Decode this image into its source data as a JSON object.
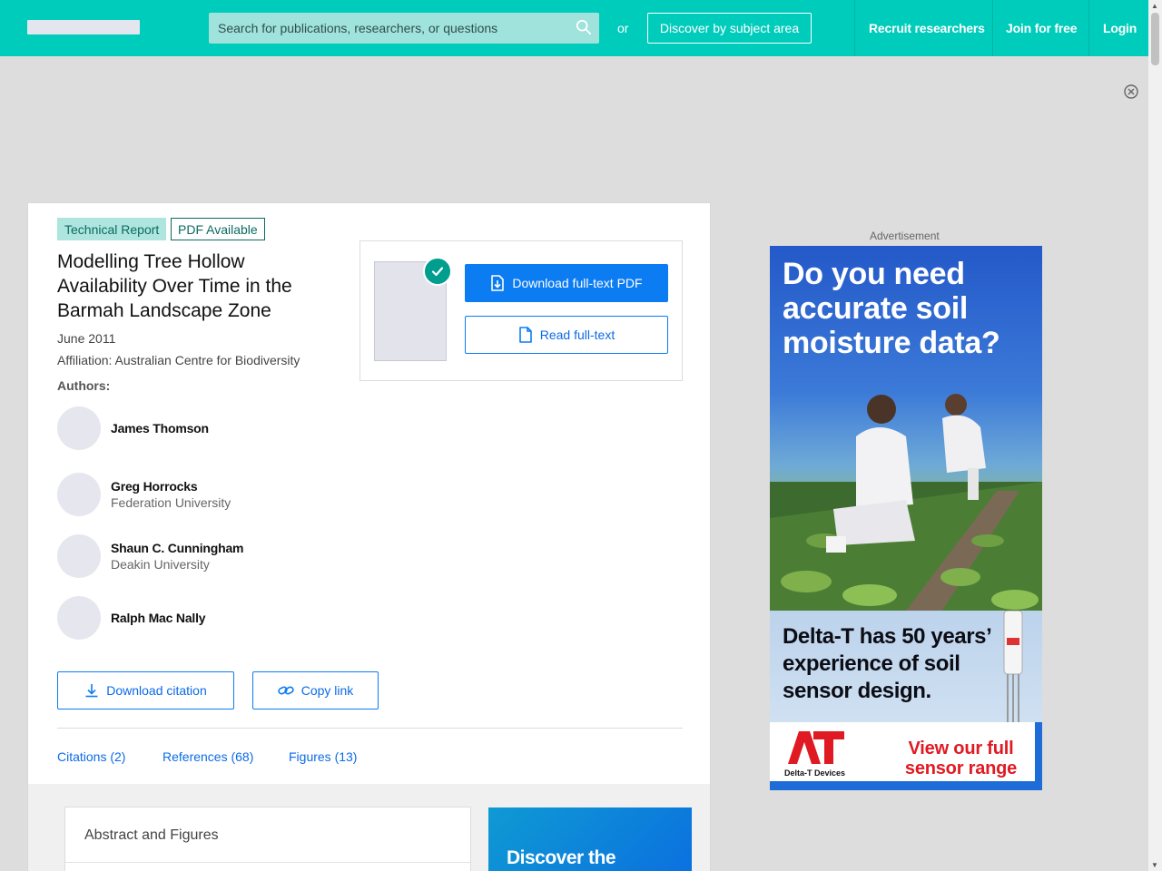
{
  "header": {
    "search_placeholder": "Search for publications, researchers, or questions",
    "or_text": "or",
    "discover_label": "Discover by subject area",
    "recruit_label": "Recruit researchers",
    "join_label": "Join for free",
    "login_label": "Login"
  },
  "publication": {
    "type_badge": "Technical Report",
    "pdf_badge": "PDF Available",
    "title": "Modelling Tree Hollow Availability Over Time in the Barmah Landscape Zone",
    "date": "June 2011",
    "affiliation": "Affiliation: Australian Centre for Biodiversity",
    "authors_label": "Authors:",
    "authors": [
      {
        "name": "James Thomson",
        "institution": ""
      },
      {
        "name": "Greg Horrocks",
        "institution": "Federation University"
      },
      {
        "name": "Shaun C. Cunningham",
        "institution": "Deakin University"
      },
      {
        "name": "Ralph Mac Nally",
        "institution": ""
      }
    ],
    "download_pdf_label": "Download full-text PDF",
    "read_fulltext_label": "Read full-text",
    "download_citation_label": "Download citation",
    "copy_link_label": "Copy link"
  },
  "tabs": [
    {
      "label": "Citations (2)"
    },
    {
      "label": "References (68)"
    },
    {
      "label": "Figures (13)"
    }
  ],
  "lower": {
    "abstract_title": "Abstract and Figures",
    "promo_text": "Discover the"
  },
  "ad": {
    "label": "Advertisement",
    "headline": "Do you need accurate soil moisture data?",
    "mid_text": "Delta-T has 50 years’ experience of soil sensor design.",
    "logo_mark": "AT",
    "logo_text": "Delta-T Devices",
    "cta": "View our full sensor range"
  },
  "colors": {
    "brand": "#00ccbb",
    "accent_blue": "#0c7cf2",
    "badge_teal": "#0b6b62"
  },
  "icons": [
    "search-icon",
    "close-circle-icon",
    "check-icon",
    "file-download-icon",
    "file-icon",
    "download-icon",
    "link-icon"
  ]
}
